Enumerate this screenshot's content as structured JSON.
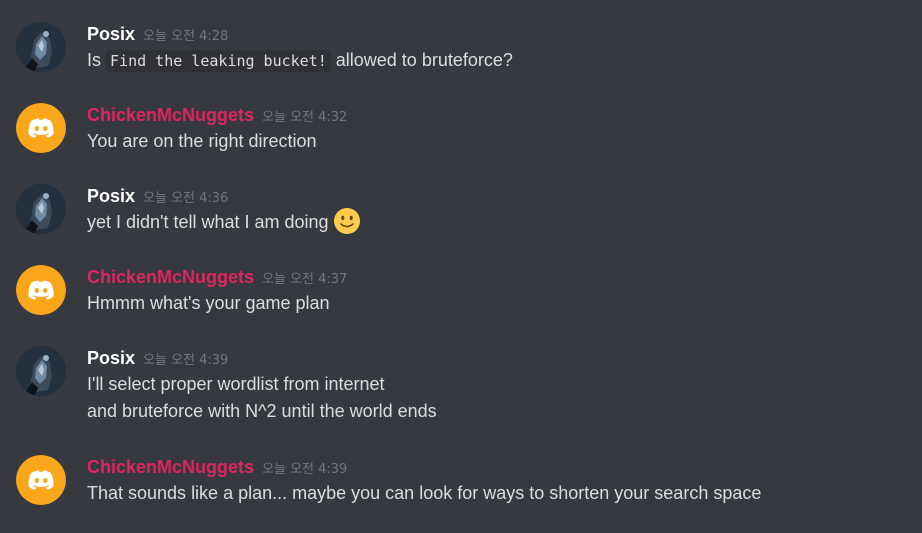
{
  "messages": [
    {
      "user": "Posix",
      "time": "오늘 오전 4:28",
      "lines": [
        {
          "pre": "Is ",
          "code": "Find the leaking bucket!",
          "post": " allowed to bruteforce?"
        }
      ]
    },
    {
      "user": "ChickenMcNuggets",
      "time": "오늘 오전 4:32",
      "lines": [
        {
          "text": "You are on the right direction"
        }
      ]
    },
    {
      "user": "Posix",
      "time": "오늘 오전 4:36",
      "lines": [
        {
          "text": "yet I didn't tell what I am doing",
          "emoji": "slightly-smiling-face"
        }
      ]
    },
    {
      "user": "ChickenMcNuggets",
      "time": "오늘 오전 4:37",
      "lines": [
        {
          "text": "Hmmm what's your game plan"
        }
      ]
    },
    {
      "user": "Posix",
      "time": "오늘 오전 4:39",
      "lines": [
        {
          "text": "I'll select proper wordlist from internet"
        },
        {
          "text": "and bruteforce with N^2 until the world ends"
        }
      ]
    },
    {
      "user": "ChickenMcNuggets",
      "time": "오늘 오전 4:39",
      "lines": [
        {
          "text": "That sounds like a plan... maybe you can look for ways to shorten your search space"
        }
      ]
    }
  ],
  "colors": {
    "background": "#36393f",
    "posix_name": "#ffffff",
    "chicken_name": "#e0245e",
    "timestamp": "#72767d",
    "text": "#dcddde",
    "discord_avatar": "#faa61a"
  },
  "icons": {
    "posix_avatar": "dark-artwork-avatar-icon",
    "chicken_avatar": "discord-logo-icon",
    "emoji": "slightly-smiling-face-icon"
  }
}
